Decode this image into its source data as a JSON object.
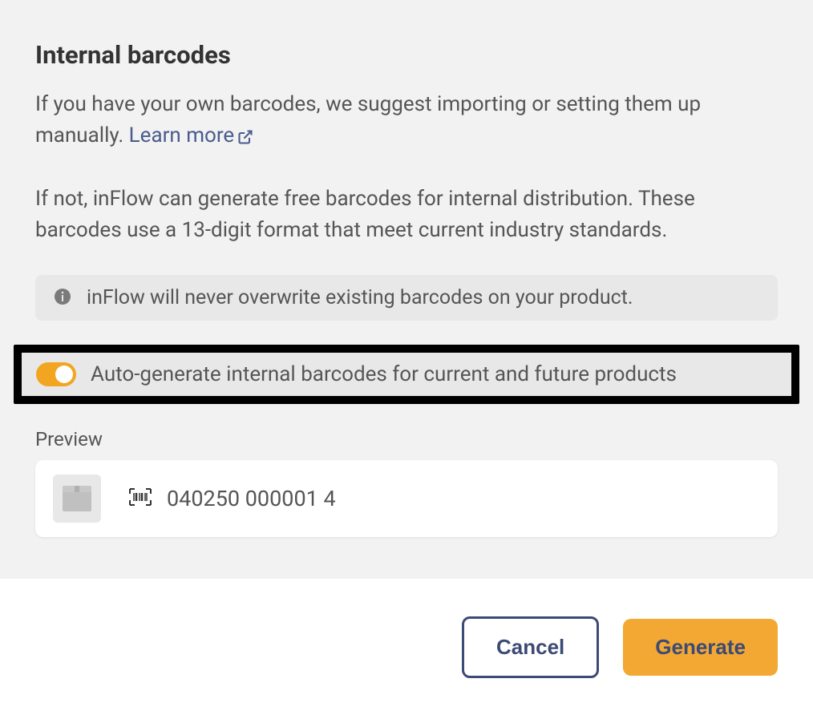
{
  "section": {
    "title": "Internal barcodes",
    "description1_prefix": "If you have your own barcodes, we suggest importing or setting them up manually. ",
    "learn_more_label": "Learn more",
    "description2": "If not, inFlow can generate free barcodes for internal distribution. These barcodes use a 13-digit format that meet current industry standards."
  },
  "info_box": {
    "text": "inFlow will never overwrite existing barcodes on your product."
  },
  "toggle": {
    "label": "Auto-generate internal barcodes for current and future products",
    "enabled": true
  },
  "preview": {
    "label": "Preview",
    "barcode_value": "040250 000001 4"
  },
  "footer": {
    "cancel_label": "Cancel",
    "generate_label": "Generate"
  }
}
